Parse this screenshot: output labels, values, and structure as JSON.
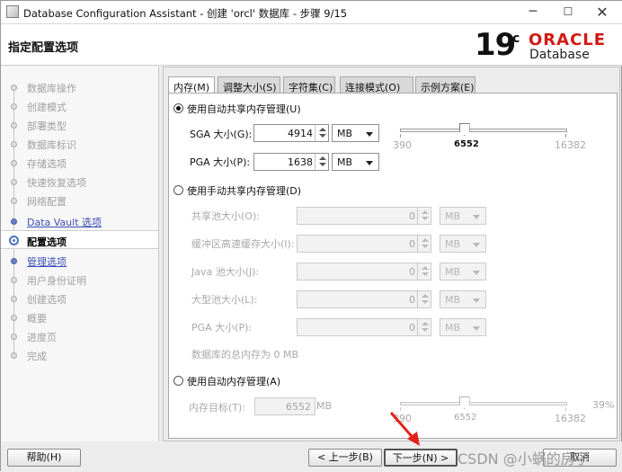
{
  "window": {
    "title": "Database Configuration Assistant - 创建 'orcl' 数据库 - 步骤 9/15",
    "min": "─",
    "max": "☐",
    "close": "✕"
  },
  "header": {
    "title": "指定配置选项",
    "logo_version": "19",
    "logo_version_sup": "c",
    "logo_brand": "ORACLE",
    "logo_product": "Database"
  },
  "sidebar": {
    "steps": [
      {
        "label": "数据库操作",
        "state": "done"
      },
      {
        "label": "创建模式",
        "state": "done"
      },
      {
        "label": "部署类型",
        "state": "done"
      },
      {
        "label": "数据库标识",
        "state": "done"
      },
      {
        "label": "存储选项",
        "state": "done"
      },
      {
        "label": "快速恢复选项",
        "state": "done"
      },
      {
        "label": "网络配置",
        "state": "done"
      },
      {
        "label": "Data Vault 选项",
        "state": "link"
      },
      {
        "label": "配置选项",
        "state": "current"
      },
      {
        "label": "管理选项",
        "state": "link"
      },
      {
        "label": "用户身份证明",
        "state": "future"
      },
      {
        "label": "创建选项",
        "state": "future"
      },
      {
        "label": "概要",
        "state": "future"
      },
      {
        "label": "进度页",
        "state": "future"
      },
      {
        "label": "完成",
        "state": "future"
      }
    ]
  },
  "tabs": [
    {
      "label": "内存(M)"
    },
    {
      "label": "调整大小(S)"
    },
    {
      "label": "字符集(C)"
    },
    {
      "label": "连接模式(O)"
    },
    {
      "label": "示例方案(E)"
    }
  ],
  "memory": {
    "auto_shared": {
      "radio_label": "使用自动共享内存管理(U)",
      "sga_label": "SGA 大小(G):",
      "sga_value": "4914",
      "sga_unit": "MB",
      "pga_label": "PGA 大小(P):",
      "pga_value": "1638",
      "pga_unit": "MB",
      "slider_min": "390",
      "slider_current": "6552",
      "slider_max": "16382",
      "slider_fraction": 0.385
    },
    "manual_shared": {
      "radio_label": "使用手动共享内存管理(D)",
      "rows": [
        {
          "label": "共享池大小(O):",
          "value": "0",
          "unit": "MB"
        },
        {
          "label": "缓冲区高速缓存大小(I):",
          "value": "0",
          "unit": "MB"
        },
        {
          "label": "Java 池大小(J):",
          "value": "0",
          "unit": "MB"
        },
        {
          "label": "大型池大小(L):",
          "value": "0",
          "unit": "MB"
        },
        {
          "label": "PGA 大小(P):",
          "value": "0",
          "unit": "MB"
        }
      ],
      "total_text": "数据库的总内存为 0 MB"
    },
    "auto_memory": {
      "radio_label": "使用自动内存管理(A)",
      "target_label": "内存目标(T):",
      "target_value": "6552",
      "target_unit": "MB",
      "slider_min": "390",
      "slider_current": "6552",
      "slider_max": "16382",
      "slider_percent": "39%",
      "slider_fraction": 0.385
    }
  },
  "footer": {
    "help": "帮助(H)",
    "back": "< 上一步(B)",
    "next": "下一步(N) >",
    "cancel": "取消"
  },
  "watermark": "CSDN @小蜗的房子"
}
